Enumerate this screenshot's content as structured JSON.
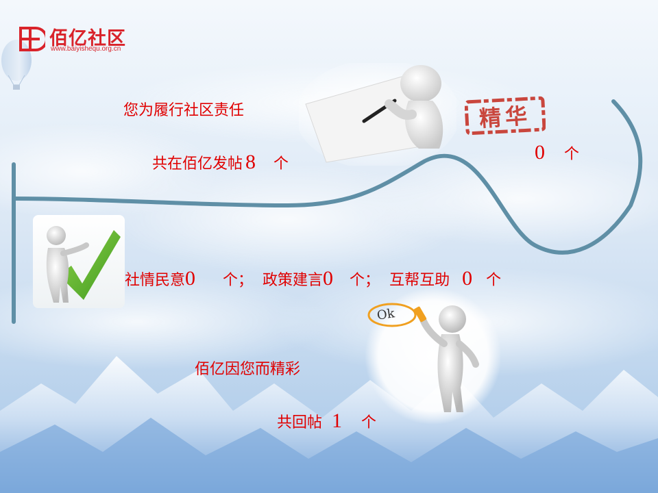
{
  "brand": {
    "name": "佰亿社区",
    "url": "www.baiyishequ.org.cn",
    "color": "#d9232a"
  },
  "text_color": "#e00000",
  "line1": {
    "label": "您为履行社区责任"
  },
  "line2": {
    "label": "共在佰亿发帖",
    "value": "8",
    "unit": "个"
  },
  "essence": {
    "stamp": "精华",
    "value": "0",
    "unit": "个"
  },
  "categories": [
    {
      "label": "社情民意",
      "value": "0",
      "unit": "个；"
    },
    {
      "label": "政策建言",
      "value": "0",
      "unit": "个；"
    },
    {
      "label": "互帮互助",
      "value": "0",
      "unit": "个"
    }
  ],
  "line4": {
    "label": "佰亿因您而精彩"
  },
  "line5": {
    "label": "共回帖",
    "value": "1",
    "unit": "个"
  },
  "ok_sign": "Ok",
  "icons": [
    "hot-air-balloon-icon",
    "figure-writing-icon",
    "figure-checkmark-icon",
    "figure-ok-sign-icon"
  ]
}
